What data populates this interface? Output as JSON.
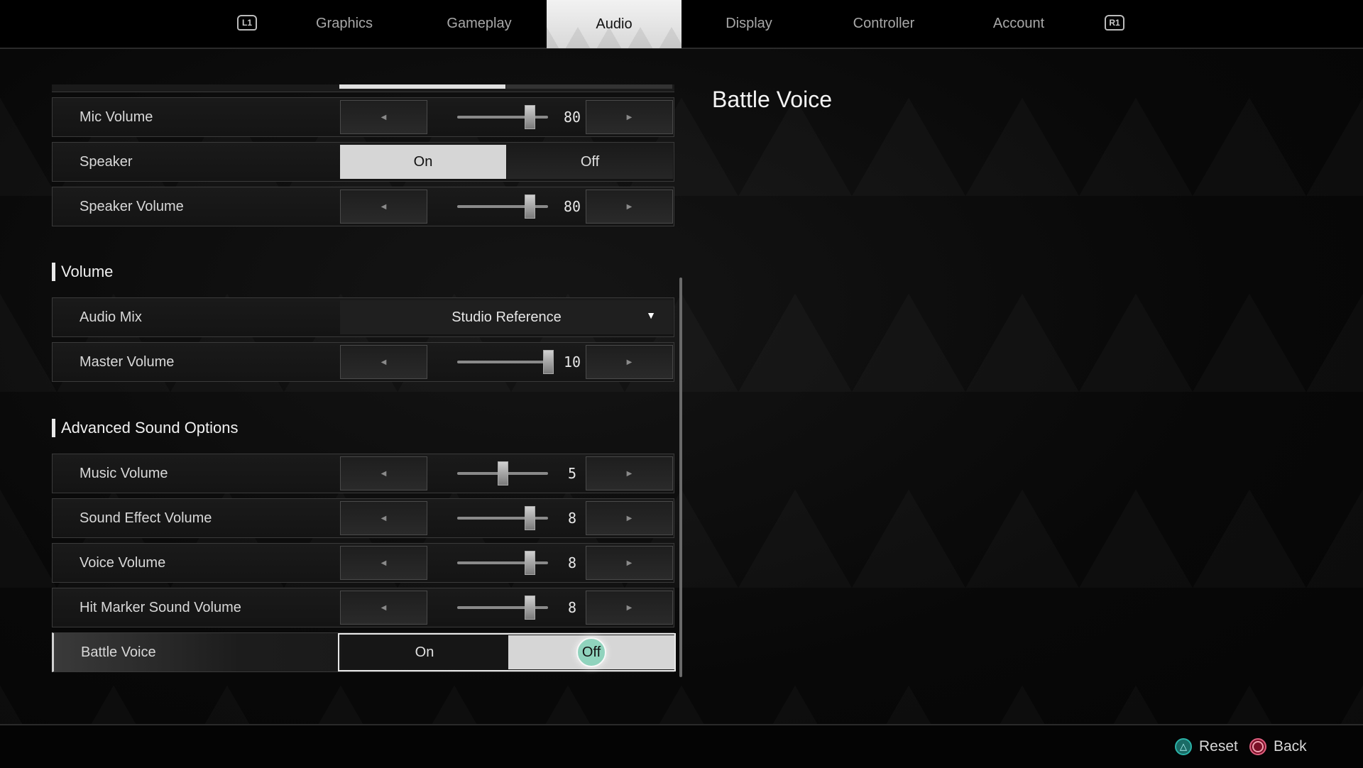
{
  "tabs": {
    "left_bumper": "L1",
    "right_bumper": "R1",
    "items": [
      {
        "label": "Graphics",
        "active": false
      },
      {
        "label": "Gameplay",
        "active": false
      },
      {
        "label": "Audio",
        "active": true
      },
      {
        "label": "Display",
        "active": false
      },
      {
        "label": "Controller",
        "active": false
      },
      {
        "label": "Account",
        "active": false
      }
    ]
  },
  "settings": {
    "voice_chat": {
      "mic_volume": {
        "label": "Mic Volume",
        "value": "80",
        "fraction": 0.8
      },
      "speaker": {
        "label": "Speaker",
        "options": [
          "On",
          "Off"
        ],
        "selected": "On"
      },
      "speaker_volume": {
        "label": "Speaker Volume",
        "value": "80",
        "fraction": 0.8
      }
    },
    "volume": {
      "title": "Volume",
      "audio_mix": {
        "label": "Audio Mix",
        "value": "Studio Reference"
      },
      "master_volume": {
        "label": "Master Volume",
        "value": "10",
        "fraction": 1.0
      }
    },
    "advanced": {
      "title": "Advanced Sound Options",
      "music_volume": {
        "label": "Music Volume",
        "value": "5",
        "fraction": 0.5
      },
      "sfx_volume": {
        "label": "Sound Effect Volume",
        "value": "8",
        "fraction": 0.8
      },
      "voice_volume": {
        "label": "Voice Volume",
        "value": "8",
        "fraction": 0.8
      },
      "hit_marker_volume": {
        "label": "Hit Marker Sound Volume",
        "value": "8",
        "fraction": 0.8
      },
      "battle_voice": {
        "label": "Battle Voice",
        "options": [
          "On",
          "Off"
        ],
        "selected": "Off"
      }
    }
  },
  "icons": {
    "left_arrow": "◀",
    "right_arrow": "▶",
    "dropdown_caret": "▼",
    "triangle": "△"
  },
  "detail": {
    "title": "Battle Voice"
  },
  "footer": {
    "reset_label": "Reset",
    "back_label": "Back",
    "reset_color": "#2bb3a8",
    "back_color": "#c0183c"
  }
}
